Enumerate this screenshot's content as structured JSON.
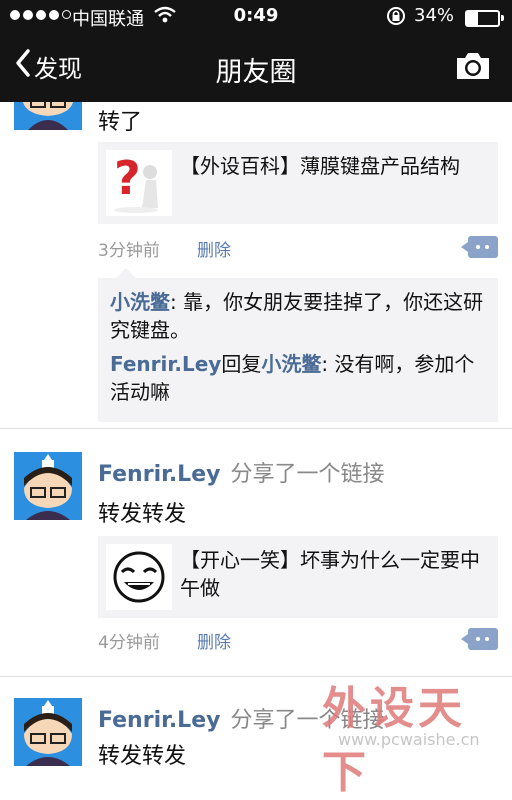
{
  "status": {
    "carrier": "中国联通",
    "time": "0:49",
    "battery_percent": "34%",
    "battery_level": 0.34
  },
  "nav": {
    "back_label": "发现",
    "title": "朋友圈"
  },
  "posts": [
    {
      "author": "",
      "action": "",
      "text": "转了",
      "link_title": "【外设百科】薄膜键盘产品结构",
      "time": "3分钟前",
      "delete_label": "删除",
      "comments": [
        {
          "author": "小洗鳖",
          "reply_to": "",
          "reply_word": "",
          "text": ": 靠，你女朋友要挂掉了，你还这研究键盘。"
        },
        {
          "author": "Fenrir.Ley",
          "reply_word": "回复",
          "reply_to": "小洗鳖",
          "text": ": 没有啊，参加个活动嘛"
        }
      ]
    },
    {
      "author": "Fenrir.Ley",
      "action": "分享了一个链接",
      "text": "转发转发",
      "link_title": "【开心一笑】坏事为什么一定要中午做",
      "time": "4分钟前",
      "delete_label": "删除"
    },
    {
      "author": "Fenrir.Ley",
      "action": "分享了一个链接",
      "text": "转发转发"
    }
  ],
  "watermark": {
    "brand": "外设天下",
    "url": "www.pcwaishe.cn"
  },
  "colors": {
    "bar_bg": "#141414",
    "name_blue": "#4a6b96",
    "delete_blue": "#5a7bb0",
    "panel_gray": "#f3f3f5"
  }
}
